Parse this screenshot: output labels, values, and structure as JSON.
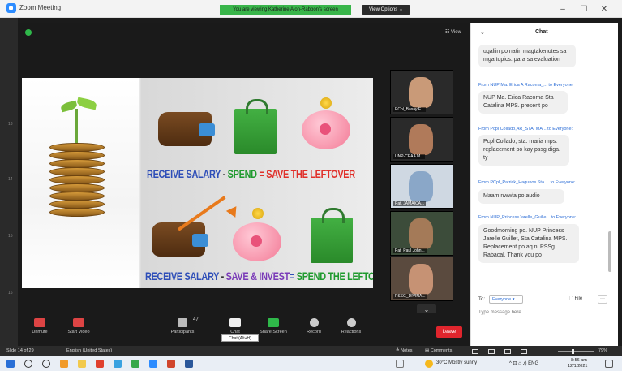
{
  "window": {
    "app_title": "Zoom Meeting",
    "viewing_banner": "You are viewing Katherine Alon-Rabbon's screen",
    "view_options": "View Options ⌄",
    "minimize": "–",
    "maximize": "☐",
    "close": "✕"
  },
  "meeting": {
    "view_label": "☷ View"
  },
  "slide": {
    "row1": {
      "a": "RECEIVE SALARY",
      "dash": " - ",
      "b": "SPEND",
      "eq": " = ",
      "c": "SAVE THE LEFTOVER"
    },
    "row2": {
      "a": "RECEIVE SALARY",
      "dash": " - ",
      "b": "SAVE & INVEST",
      "eq": "= ",
      "c": "SPEND THE LEFTOVER"
    }
  },
  "participants": [
    {
      "name": "PCpl_Basay E..."
    },
    {
      "name": "UNP-CEAA M..."
    },
    {
      "name": "Pat. JAMAICA..."
    },
    {
      "name": "Pat_Paul John..."
    },
    {
      "name": "PSSG_DIVINA..."
    }
  ],
  "toolbar": {
    "unmute": "Unmute",
    "start_video": "Start Video",
    "participants": "Participants",
    "participants_count": "47",
    "chat": "Chat",
    "share_screen": "Share Screen",
    "record": "Record",
    "reactions": "Reactions",
    "leave": "Leave",
    "chat_tooltip": "Chat (Alt+H)",
    "caret": "⌃",
    "scroll_down": "⌄"
  },
  "chat": {
    "title": "Chat",
    "collapse": "⌄",
    "messages": [
      {
        "from": "",
        "text": "ugaliin po natin magtakenotes sa mga topics. para sa evaluation"
      },
      {
        "from": "From NUP Ma. Erica A Racoma_... to Everyone:",
        "text": "NUP Ma. Erica Racoma Sta Catalina MPS. present po"
      },
      {
        "from": "From Pcpl Collado,AR_STA. MA... to Everyone:",
        "text": "Pcpl Collado, sta. maria mps. replacement po kay pssg diga. ty"
      },
      {
        "from": "From PCpl_Patrick_Hagunos Sta ... to Everyone:",
        "text": "Maam nwwla po audio"
      },
      {
        "from": "From NUP_PrincessJarelle_Guille... to Everyone:",
        "text": "Goodmorning po. NUP Princess Jarelle Guillet, Sta Catalina MPS. Replacement po aq ni PSSg Rabacal. Thank you po"
      }
    ],
    "to_label": "To:",
    "to_value": "Everyone ▾",
    "file_button": "🗋 File",
    "more_button": "···",
    "placeholder": "Type message here..."
  },
  "statusbar": {
    "slide_info": "Slide 14 of 29",
    "language": "English (United States)",
    "notes": "≙ Notes",
    "comments": "▤ Comments",
    "zoom": "79%"
  },
  "taskbar": {
    "weather": "30°C  Mostly sunny",
    "tray": "^ ⊡ ⌂ ♪) ENG",
    "time": "8:56 am",
    "date": "12/1/2021"
  },
  "ruler": [
    "13",
    "14",
    "15",
    "16"
  ]
}
